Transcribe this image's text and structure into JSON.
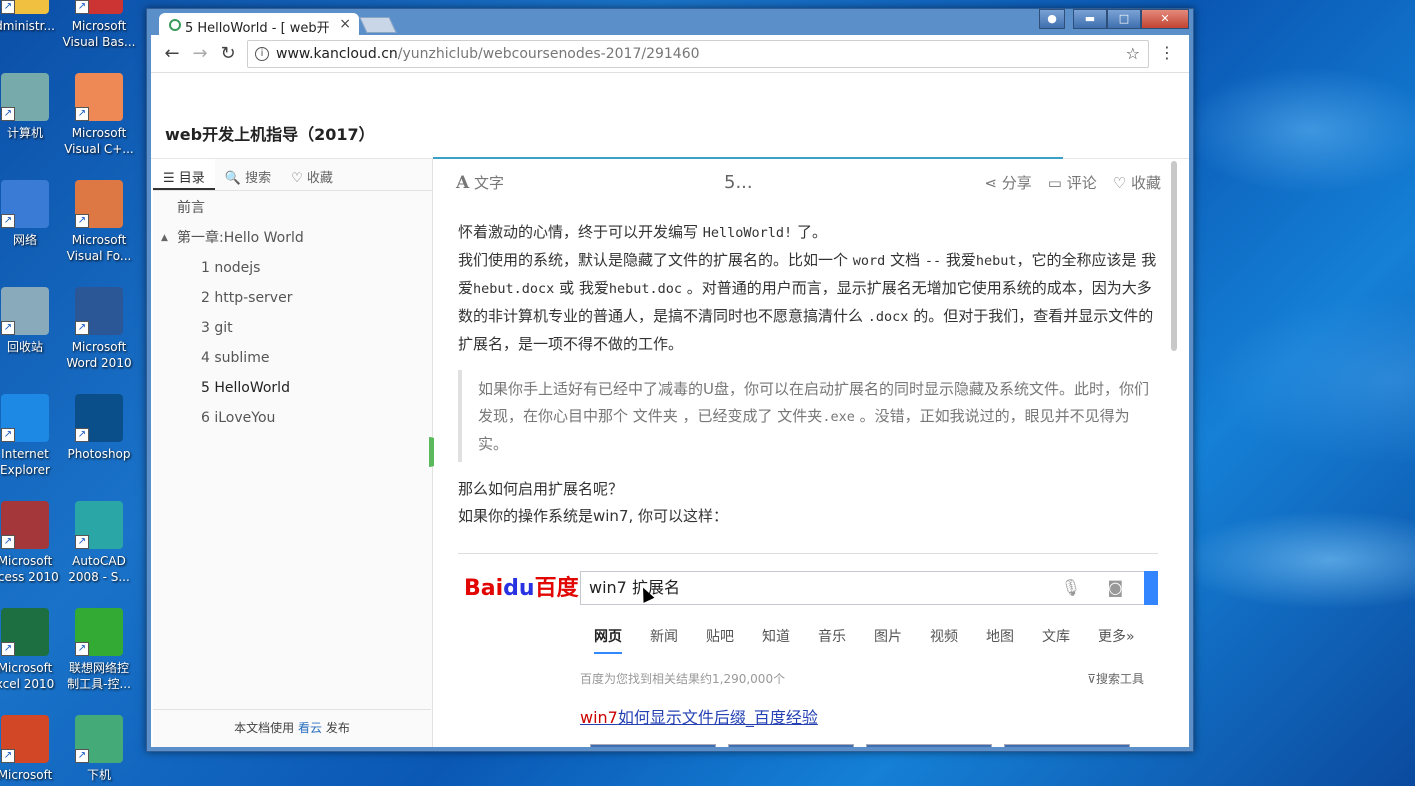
{
  "desktop": {
    "icons": [
      {
        "label": "dministr...",
        "name": "admin-folder-icon"
      },
      {
        "label": "Microsoft\nVisual Bas...",
        "name": "visual-basic-icon"
      },
      {
        "label": "计算机",
        "name": "computer-icon"
      },
      {
        "label": "Microsoft\nVisual C+...",
        "name": "visual-cpp-icon"
      },
      {
        "label": "网络",
        "name": "network-icon"
      },
      {
        "label": "Microsoft\nVisual Fo...",
        "name": "visual-foxpro-icon"
      },
      {
        "label": "回收站",
        "name": "recycle-bin-icon"
      },
      {
        "label": "Microsoft\nWord 2010",
        "name": "word-icon"
      },
      {
        "label": "Internet\nExplorer",
        "name": "internet-explorer-icon"
      },
      {
        "label": "Photoshop",
        "name": "photoshop-icon"
      },
      {
        "label": "Microsoft\nccess 2010",
        "name": "access-icon"
      },
      {
        "label": "AutoCAD\n2008 - S...",
        "name": "autocad-icon"
      },
      {
        "label": "Microsoft\nxcel 2010",
        "name": "excel-icon"
      },
      {
        "label": "联想网络控\n制工具-控...",
        "name": "lenovo-network-icon"
      },
      {
        "label": "Microsoft",
        "name": "powerpoint-icon"
      },
      {
        "label": "下机",
        "name": "logoff-icon"
      }
    ]
  },
  "browser": {
    "tab_title": "5 HelloWorld - [ web开",
    "tab_close": "×",
    "url_host": "www.kancloud.cn",
    "url_path": "/yunzhiclub/webcoursenodes-2017/291460",
    "back": "←",
    "forward": "→",
    "reload": "↻",
    "star": "☆",
    "menu": "⋮",
    "win_minimize": "▬",
    "win_maximize": "□",
    "win_close": "✕"
  },
  "book": {
    "title": "web开发上机指导（2017）"
  },
  "sidebar": {
    "tabs": [
      "☰ 目录",
      "🔍 搜索",
      "♡ 收藏"
    ],
    "toc": [
      {
        "label": "前言",
        "level": 0
      },
      {
        "label": "第一章:Hello World",
        "level": 0,
        "expanded": true
      },
      {
        "label": "1 nodejs",
        "level": 1
      },
      {
        "label": "2 http-server",
        "level": 1
      },
      {
        "label": "3 git",
        "level": 1
      },
      {
        "label": "4 sublime",
        "level": 1
      },
      {
        "label": "5 HelloWorld",
        "level": 1,
        "current": true
      },
      {
        "label": "6 iLoveYou",
        "level": 1
      }
    ],
    "footer_prefix": "本文档使用",
    "footer_link": "看云",
    "footer_suffix": "发布"
  },
  "article_bar": {
    "font_icon": "A",
    "font_label": "文字",
    "chapter": "5...",
    "share": "分享",
    "comment": "评论",
    "favorite": "收藏"
  },
  "article": {
    "p1_a": "怀着激动的心情，终于可以开发编写 ",
    "p1_code": "HelloWorld!",
    "p1_b": " 了。",
    "p2_a": "我们使用的系统，默认是隐藏了文件的扩展名的。比如一个 ",
    "p2_code1": "word",
    "p2_b": " 文档 ",
    "p2_code2": "--",
    "p2_c": " 我爱",
    "p2_code3": "hebut",
    "p2_d": "，它的全称应该是 我爱",
    "p2_code4": "hebut.docx",
    "p2_e": " 或 我爱",
    "p2_code5": "hebut.doc",
    "p2_f": " 。对普通的用户而言，显示扩展名无增加它使用系统的成本，因为大多数的非计算机专业的普通人，是搞不清同时也不愿意搞清什么 ",
    "p2_code6": ".docx",
    "p2_g": " 的。但对于我们，查看并显示文件的扩展名，是一项不得不做的工作。",
    "quote_a": "如果你手上适好有已经中了减毒的U盘，你可以在启动扩展名的同时显示隐藏及系统文件。此时，你们发现，在你心目中那个 文件夹 ，已经变成了 文件夹",
    "quote_code": ".exe",
    "quote_b": " 。没错，正如我说过的，眼见并不见得为实。",
    "p3": "那么如何启用扩展名呢？",
    "p4": "如果你的操作系统是win7, 你可以这样："
  },
  "baidu": {
    "logo_left": "Bai",
    "logo_mid": "du",
    "logo_right": "百度",
    "query": "win7 扩展名",
    "tabs": [
      "网页",
      "新闻",
      "贴吧",
      "知道",
      "音乐",
      "图片",
      "视频",
      "地图",
      "文库",
      "更多»"
    ],
    "result_count": "百度为您找到相关结果约1,290,000个",
    "search_tools": "搜索工具",
    "result_hl": "win7",
    "result_rest": "如何显示文件后缀_百度经验"
  },
  "colors": {
    "accent_green": "#5cb85c",
    "link_blue": "#2440b3",
    "baidu_red": "#e10602",
    "baidu_blue": "#2932e1"
  }
}
